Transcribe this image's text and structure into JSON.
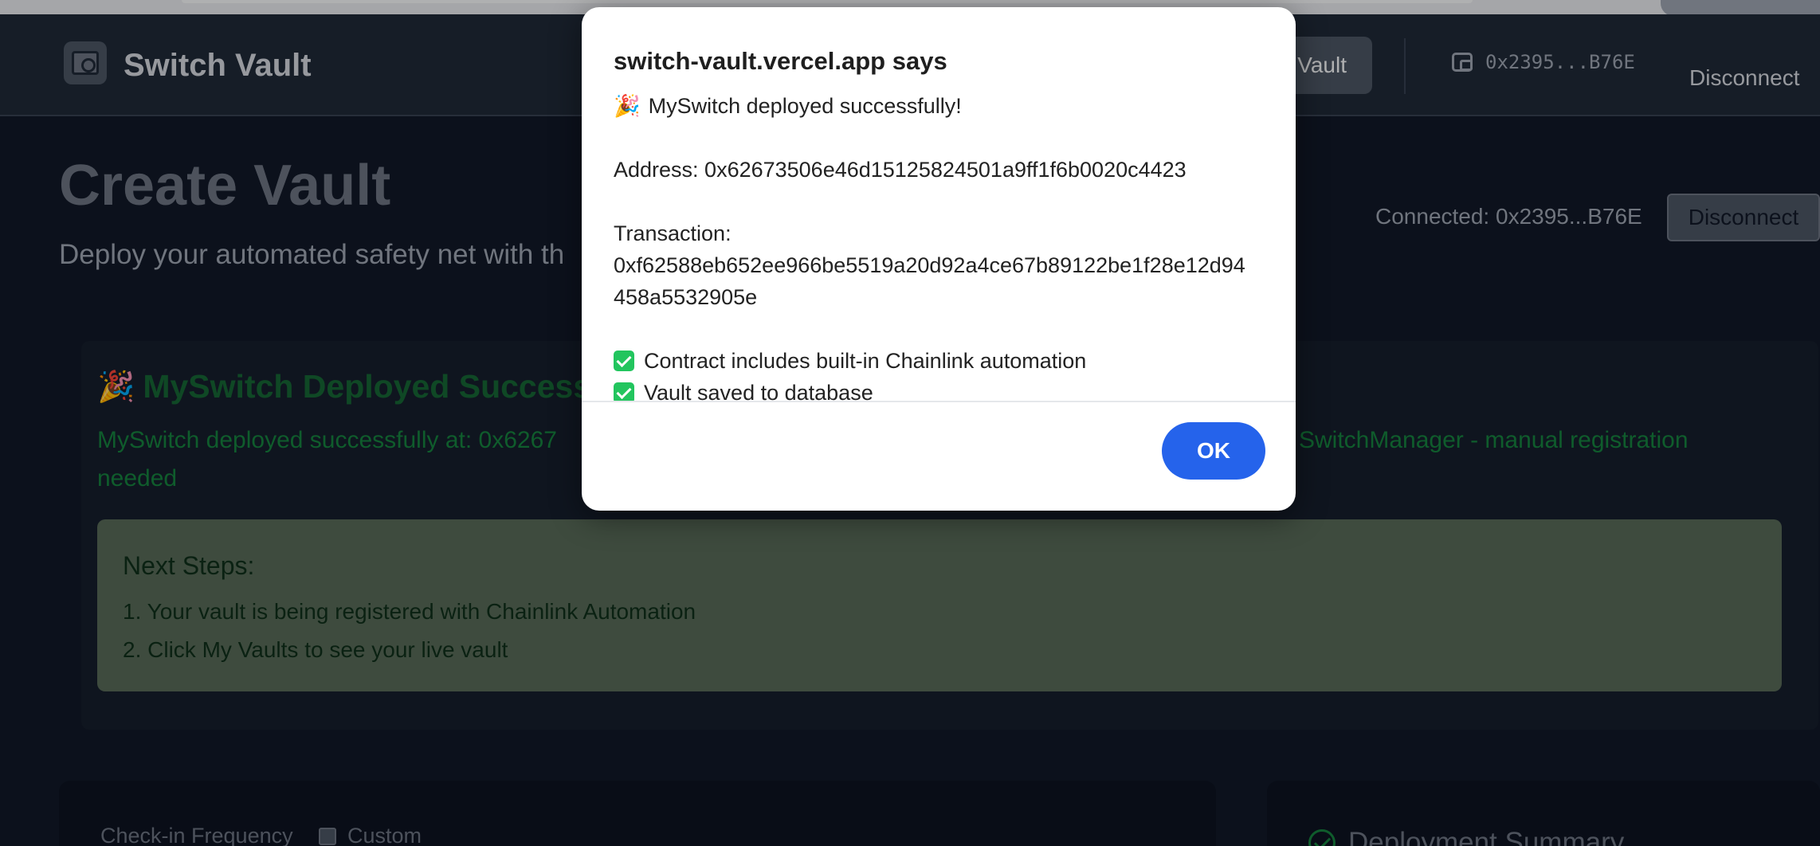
{
  "header": {
    "app_title": "Switch Vault",
    "nav_vault_label": "Vault",
    "wallet_address": "0x2395...B76E",
    "disconnect_label": "Disconnect"
  },
  "page": {
    "title": "Create Vault",
    "subtitle": "Deploy your automated safety net with th",
    "connected_text": "Connected: 0x2395...B76E",
    "connected_disconnect_label": "Disconnect"
  },
  "success": {
    "icon": "🎉",
    "title": "MySwitch Deployed Success",
    "message_left": "MySwitch deployed successfully at: 0x6267",
    "message_right": "SwitchManager - manual registration",
    "message_line2": "needed",
    "next_steps_title": "Next Steps:",
    "next_steps": [
      "1. Your vault is being registered with Chainlink Automation",
      "2. Click My Vaults to see your live vault"
    ]
  },
  "form": {
    "frequency_label": "Check-in Frequency",
    "custom_label": "Custom"
  },
  "summary": {
    "title": "Deployment Summary"
  },
  "dialog": {
    "title": "switch-vault.vercel.app says",
    "icon": "🎉",
    "line1": "MySwitch deployed successfully!",
    "address_line": "Address: 0x62673506e46d15125824501a9ff1f6b0020c4423",
    "transaction_label": "Transaction:",
    "transaction_hash": "0xf62588eb652ee966be5519a20d92a4ce67b89122be1f28e12d94458a5532905e",
    "check1": "Contract includes built-in Chainlink automation",
    "check2": "Vault saved to database",
    "ok_label": "OK"
  }
}
